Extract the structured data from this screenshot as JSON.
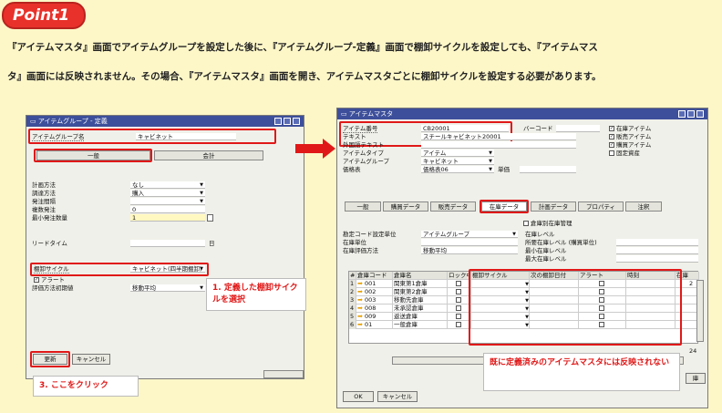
{
  "badge": "Point1",
  "intro": {
    "line1": "『アイテムマスタ』画面でアイテムグループを設定した後に、『アイテムグループ-定義』画面で棚卸サイクルを設定しても、『アイテムマス",
    "line2": "タ』画面には反映されません。その場合、『アイテムマスタ』画面を開き、アイテムマスタごとに棚卸サイクルを設定する必要があります。"
  },
  "left": {
    "title": "アイテムグループ - 定義",
    "group_label": "アイテムグループ名",
    "group_value": "キャビネット",
    "tab_general": "一般",
    "tab_accounting": "会計",
    "fields": [
      {
        "label": "計画方法",
        "value": "なし"
      },
      {
        "label": "調達方法",
        "value": "購入"
      },
      {
        "label": "発注間隔",
        "value": ""
      },
      {
        "label": "複数発注",
        "value": "0"
      },
      {
        "label": "最小発注数量",
        "value": "1"
      }
    ],
    "leadtime": "リードタイム",
    "day": "日",
    "cycle_label": "棚卸サイクル",
    "cycle_value": "キャビネット(四半期棚卸)",
    "alert": "アラート",
    "valuation_label": "評価方法初期値",
    "valuation_value": "移動平均",
    "update": "更新",
    "cancel": "キャンセル"
  },
  "note1": "1. 定義した棚卸サイクルを選択",
  "note3": "3. ここをクリック",
  "note2": "既に定義済みのアイテムマスタには反映されない",
  "right": {
    "title": "アイテムマスタ",
    "rows": [
      {
        "label": "アイテム番号",
        "value": "CB20001"
      },
      {
        "label": "テキスト",
        "value": "スチールキャビネット20001"
      },
      {
        "label": "外国語テキスト",
        "value": ""
      },
      {
        "label": "アイテムタイプ",
        "value": "アイテム"
      },
      {
        "label": "アイテムグループ",
        "value": "キャビネット"
      },
      {
        "label": "価格表",
        "value": "価格表06"
      }
    ],
    "barcode": "バーコード",
    "unit_price": "単価",
    "checks": [
      "在庫アイテム",
      "販売アイテム",
      "購買アイテム",
      "固定資産"
    ],
    "tabs": [
      "一般",
      "購買データ",
      "販売データ",
      "在庫データ",
      "計画データ",
      "プロパティ",
      "注釈"
    ],
    "whse_manage": "倉庫別在庫管理",
    "set_gl": "勘定コード設定単位",
    "set_gl_value": "アイテムグループ",
    "inv_unit": "在庫単位",
    "valuation": "在庫評価方法",
    "valuation_value": "移動平均",
    "inv_level": "在庫レベル",
    "req_level": "所要在庫レベル (購買単位)",
    "min_level": "最小在庫レベル",
    "max_level": "最大在庫レベル",
    "cols": [
      "#",
      "倉庫コード",
      "倉庫名",
      "ロック中",
      "棚卸サイクル",
      "次の棚卸日付",
      "アラート",
      "時刻",
      "在庫"
    ],
    "whs": [
      {
        "n": "1",
        "code": "001",
        "name": "関東第1倉庫"
      },
      {
        "n": "2",
        "code": "002",
        "name": "関東第2倉庫"
      },
      {
        "n": "3",
        "code": "003",
        "name": "移動先倉庫"
      },
      {
        "n": "4",
        "code": "008",
        "name": "未承認倉庫"
      },
      {
        "n": "5",
        "code": "009",
        "name": "返送倉庫"
      },
      {
        "n": "6",
        "code": "01",
        "name": "一般倉庫"
      }
    ],
    "stock_first": "2",
    "stock_total": "24",
    "ok": "OK",
    "cancel": "キャンセル",
    "update_partial": "庫"
  }
}
